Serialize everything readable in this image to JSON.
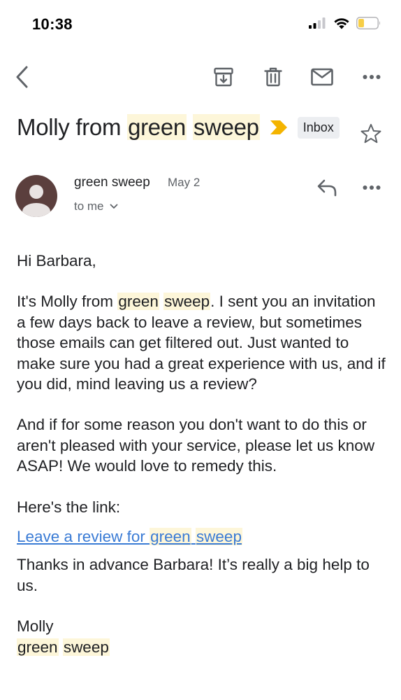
{
  "status_bar": {
    "time": "10:38"
  },
  "toolbar": {
    "back_icon": "chevron-left-icon",
    "archive_icon": "archive-icon",
    "delete_icon": "trash-icon",
    "mark_unread_icon": "mail-icon",
    "more_icon": "more-horizontal-icon"
  },
  "email": {
    "subject_prefix": "Molly from",
    "subject_hl1": "green",
    "subject_hl2": "sweep",
    "label_chip": "Inbox",
    "importance_color": "#F4B400",
    "sender_name": "green sweep",
    "date": "May 2",
    "recipient": "to me",
    "body": {
      "greeting": "Hi Barbara,",
      "p1_pre": "It's Molly from ",
      "p1_hl1": "green",
      "p1_hl2": "sweep",
      "p1_post": ". I sent you an invitation a few days back to leave a review, but sometimes those emails can get filtered out. Just wanted to make sure you had a great experience with us, and if you did, mind leaving us a review?",
      "p2": "And if for some reason you don't want to do this or aren't pleased with your service, please let us know ASAP! We would love to remedy this.",
      "p3": "Here's the link:",
      "link_pre": "Leave a review for ",
      "link_hl1": "green",
      "link_hl2": "sweep",
      "p4": "Thanks in advance Barbara! It’s really a big help to us.",
      "signature_name": "Molly",
      "signature_hl1": "green",
      "signature_hl2": "sweep"
    }
  },
  "colors": {
    "highlight": "#FDF6D9",
    "link": "#3A7BD5",
    "avatar_bg": "#5B3F3D",
    "battery": "#F7CE46"
  }
}
